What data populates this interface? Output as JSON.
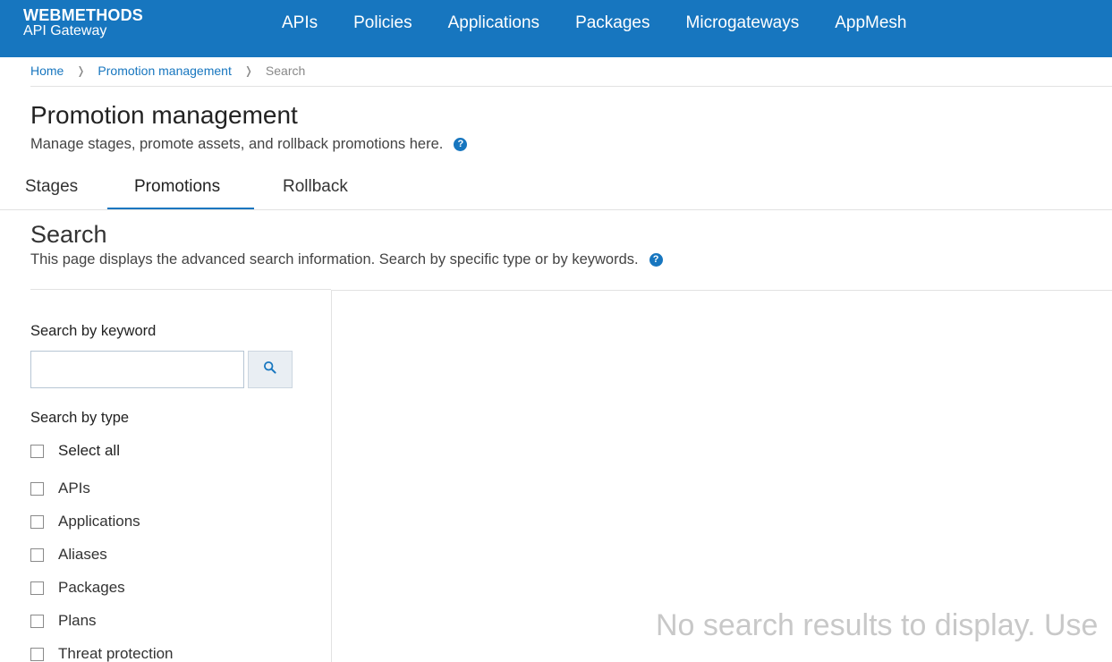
{
  "brand": {
    "line1": "WEBMETHODS",
    "line2": "API Gateway"
  },
  "nav": {
    "items": [
      "APIs",
      "Policies",
      "Applications",
      "Packages",
      "Microgateways",
      "AppMesh"
    ]
  },
  "breadcrumb": {
    "home": "Home",
    "section": "Promotion management",
    "current": "Search",
    "separator": "❭"
  },
  "header": {
    "title": "Promotion management",
    "description": "Manage stages, promote assets, and rollback promotions here.",
    "help_glyph": "?"
  },
  "tabs": {
    "stages": "Stages",
    "promotions": "Promotions",
    "rollback": "Rollback",
    "active": "Promotions"
  },
  "search": {
    "title": "Search",
    "description": "This page displays the advanced search information. Search by specific type or by keywords.",
    "keyword_label": "Search by keyword",
    "keyword_value": "",
    "type_label": "Search by type",
    "select_all": "Select all",
    "types": [
      "APIs",
      "Applications",
      "Aliases",
      "Packages",
      "Plans",
      "Threat protection"
    ]
  },
  "results": {
    "empty_message": "No search results to display. Use"
  },
  "colors": {
    "accent": "#1776bf",
    "topbar": "#1776bf",
    "empty_text": "#c8c8c8"
  },
  "icons": {
    "search": "search-icon",
    "help": "help-icon"
  }
}
